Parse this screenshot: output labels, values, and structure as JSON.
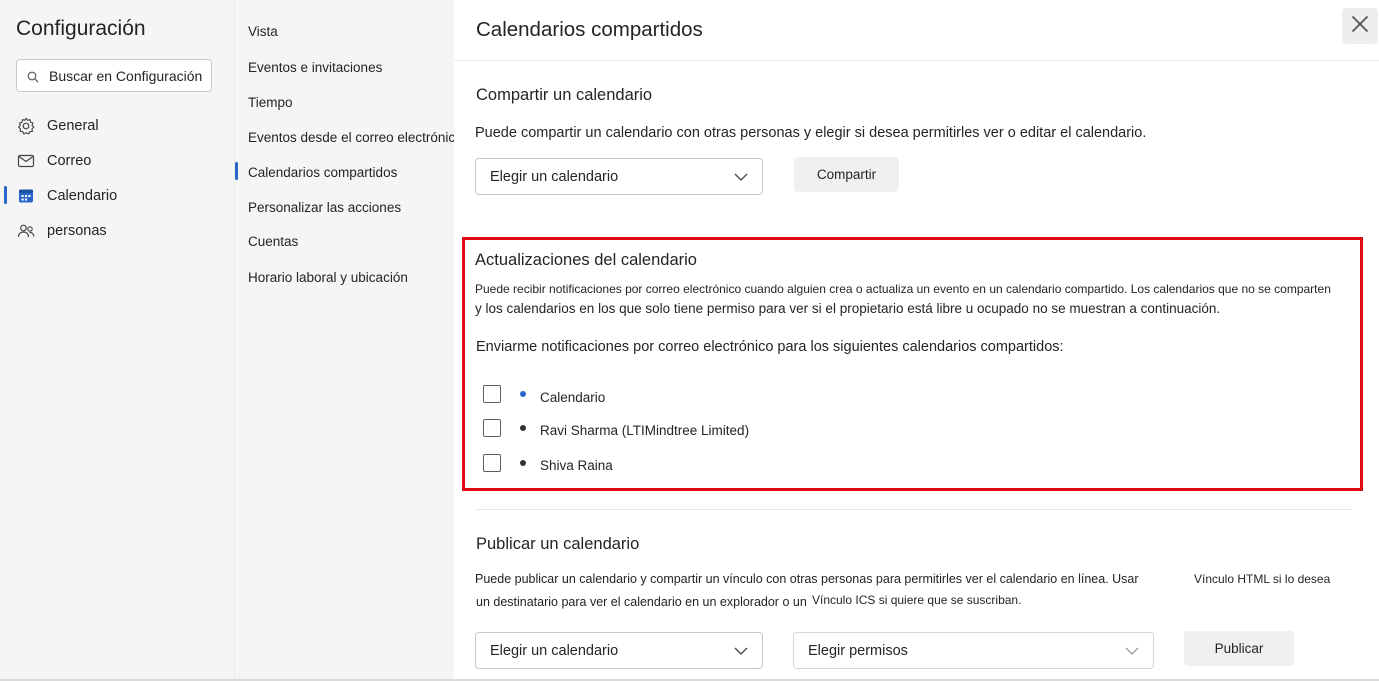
{
  "app": {
    "title": "Configuración"
  },
  "search": {
    "placeholder": "Buscar en Configuración",
    "icon": "search-icon"
  },
  "nav": [
    {
      "label": "General",
      "icon": "gear-icon",
      "selected": false
    },
    {
      "label": "Correo",
      "icon": "mail-icon",
      "selected": false
    },
    {
      "label": "Calendario",
      "icon": "calendar-icon",
      "selected": true
    },
    {
      "label": "personas",
      "icon": "people-icon",
      "selected": false
    }
  ],
  "subnav": [
    {
      "label": "Vista"
    },
    {
      "label": "Eventos e invitaciones"
    },
    {
      "label": "Tiempo"
    },
    {
      "label": "Eventos desde el correo electrónico"
    },
    {
      "label": "Calendarios compartidos",
      "selected": true
    },
    {
      "label": "Personalizar las acciones"
    },
    {
      "label": "Cuentas"
    },
    {
      "label": "Horario laboral y ubicación"
    }
  ],
  "page": {
    "title": "Calendarios compartidos",
    "close_icon": "close-icon"
  },
  "share": {
    "title": "Compartir un calendario",
    "description": "Puede compartir un calendario con otras personas y elegir si desea permitirles ver o editar el calendario.",
    "dropdown_label": "Elegir un calendario",
    "button_label": "Compartir"
  },
  "updates": {
    "title": "Actualizaciones del calendario",
    "description_line1": "Puede recibir notificaciones por correo electrónico cuando alguien crea o actualiza un evento en un calendario compartido. Los calendarios que no se comparten",
    "description_line2": "y los calendarios en los que solo tiene permiso para ver si el propietario está libre u ocupado no se muestran a continuación.",
    "prompt": "Enviarme notificaciones por correo electrónico para los siguientes calendarios compartidos:",
    "calendars": [
      {
        "label": "Calendario",
        "color": "#2a66c9",
        "checked": false
      },
      {
        "label": "Ravi Sharma (LTIMindtree Limited)",
        "color": "#333333",
        "checked": false
      },
      {
        "label": "Shiva Raina",
        "color": "#333333",
        "checked": false
      }
    ]
  },
  "publish": {
    "title": "Publicar un calendario",
    "line1_a": "Puede publicar un calendario y compartir un vínculo con otras personas para permitirles ver el calendario en línea. Usar",
    "line1_b": "Vínculo HTML si lo desea",
    "line2_a": "un destinatario para ver el calendario en un explorador o un",
    "line2_b": "Vínculo ICS si quiere que se suscriban.",
    "calendar_dropdown": "Elegir un calendario",
    "permissions_dropdown": "Elegir permisos",
    "button_label": "Publicar"
  },
  "colors": {
    "accent": "#2a66c9",
    "highlight": "#e00a16"
  }
}
